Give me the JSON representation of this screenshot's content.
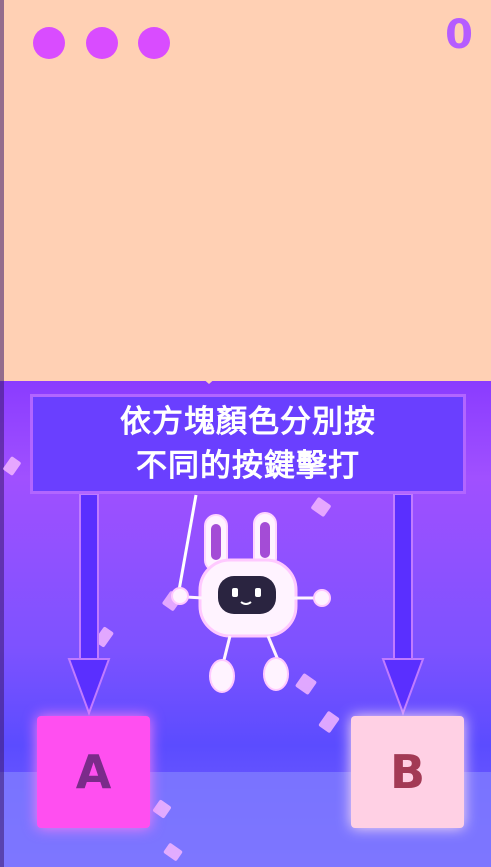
{
  "hud": {
    "lives": 3,
    "score": "0"
  },
  "tutorial": {
    "line1": "依方塊顏色分別按",
    "line2": "不同的按鍵擊打"
  },
  "buttons": {
    "a_label": "A",
    "b_label": "B"
  },
  "colors": {
    "sky": "#ffd0b4",
    "life": "#d94cff",
    "score": "#b55cff",
    "banner": "#6a3fff",
    "button_a": "#ff4ff0",
    "button_b": "#ffd0e4"
  },
  "icons": {
    "character": "bunny-robot-icon",
    "arrow": "arrow-down-icon"
  }
}
